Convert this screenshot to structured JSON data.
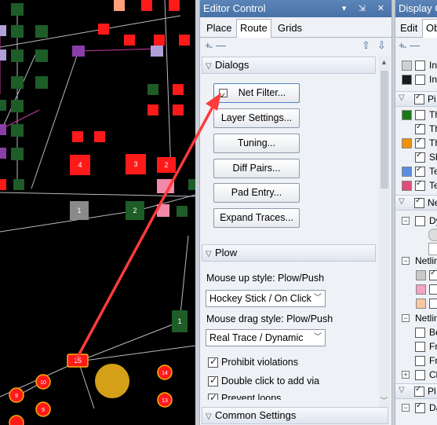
{
  "editor": {
    "title": "Editor Control",
    "title_buttons": "▾ ⇲ ✕",
    "tabs": [
      {
        "label": "Place"
      },
      {
        "label": "Route"
      },
      {
        "label": "Grids"
      }
    ],
    "active_tab": "Route",
    "dialogs": {
      "header": "Dialogs",
      "net_filter_checked": true,
      "buttons": [
        "Net Filter...",
        "Layer Settings...",
        "Tuning...",
        "Diff Pairs...",
        "Pad Entry...",
        "Expand Traces..."
      ]
    },
    "plow": {
      "header": "Plow",
      "mouse_up_label": "Mouse up style: Plow/Push",
      "mouse_up_value": "Hockey Stick / On Click",
      "mouse_drag_label": "Mouse drag style: Plow/Push",
      "mouse_drag_value": "Real Trace / Dynamic",
      "options": [
        {
          "label": "Prohibit violations",
          "checked": true
        },
        {
          "label": "Double click to add via",
          "checked": true
        },
        {
          "label": "Prevent loops",
          "checked": true
        }
      ]
    },
    "common": {
      "header": "Common Settings"
    }
  },
  "display": {
    "title": "Display C",
    "tabs": [
      "Edit",
      "Ob"
    ],
    "rows": [
      {
        "text": "In",
        "swatch": "#d0d0d0",
        "checked": false
      },
      {
        "text": "In",
        "swatch": "#1a1a1a",
        "checked": false
      },
      {
        "text": "Pi",
        "section": true,
        "checked": true
      },
      {
        "text": "Th",
        "swatch": "#1a7a1a",
        "checked": false
      },
      {
        "text": "Th",
        "swatch": null,
        "checked": true
      },
      {
        "text": "Th",
        "swatch": "#f0920a",
        "checked": true
      },
      {
        "text": "Sh",
        "swatch": null,
        "checked": true
      },
      {
        "text": "Te",
        "swatch": "#5b8de0",
        "checked": true
      },
      {
        "text": "Te",
        "swatch": "#e04c7a",
        "checked": true
      },
      {
        "text": "Ne",
        "section": true,
        "checked": true
      },
      {
        "text": "Dy",
        "checked": false
      },
      {
        "text": "Netlin",
        "checked": false
      },
      {
        "text": "Netlin",
        "checked": false
      },
      {
        "text": "Be",
        "checked": false
      },
      {
        "text": "Fr",
        "checked": false
      },
      {
        "text": "Fr",
        "checked": false
      },
      {
        "text": "Cl",
        "checked": false
      },
      {
        "text": "Pl",
        "section": true,
        "checked": true
      },
      {
        "text": "Da",
        "checked": true
      }
    ]
  },
  "canvas": {
    "pads": [
      {
        "label": "4",
        "color": "#ff1a1a"
      },
      {
        "label": "3",
        "color": "#ff1a1a"
      },
      {
        "label": "2",
        "color": "#ff1a1a"
      },
      {
        "label": "1",
        "color": "#8a8a8a"
      },
      {
        "label": "2",
        "color": "#1e5c28"
      },
      {
        "label": "1",
        "color": "#1e5c28"
      },
      {
        "label": "15",
        "color": "#ff1a1a"
      },
      {
        "label": "10",
        "color": "#ff1a1a"
      },
      {
        "label": "9",
        "color": "#ff1a1a"
      },
      {
        "label": "9",
        "color": "#ff1a1a"
      },
      {
        "label": "14",
        "color": "#ff1a1a"
      },
      {
        "label": "13",
        "color": "#ff1a1a"
      }
    ],
    "arrow_color": "#ff3b3b"
  }
}
